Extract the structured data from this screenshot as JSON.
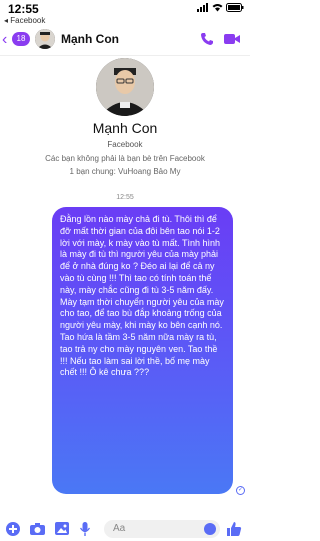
{
  "status": {
    "time": "12:55",
    "back_app": "◂ Facebook"
  },
  "header": {
    "badge": "18",
    "name": "Mạnh Con"
  },
  "profile": {
    "name": "Mạnh Con",
    "subtitle": "Facebook",
    "note": "Các bạn không phải là bạn bè trên Facebook",
    "mutual": "1 bạn chung: VuHoang Bảo My"
  },
  "conversation": {
    "timestamp": "12:55",
    "message": "Đằng lồn nào mày chả đi tù. Thôi thì để đỡ mất thời gian của đôi bên tao nói 1-2 lời với mày, k mày vào tù mất. Tình hình là mày đi tù thì người yêu của mày phải để ở nhà đúng ko ? Đéo ai lại để cả ny vào tù cùng !!! Thì tao có tính toán thế này, mày chắc cũng đi tù 3-5 năm đấy. Mày tạm thời chuyển người yêu của mày cho tao, để tao bù đắp khoảng trống của người yêu mày, khi mày ko bên cạnh nó. Tao hứa là tầm 3-5 năm nữa mày ra tù, tao trả ny cho mày nguyên ven. Tao thề !!! Nếu tao làm sai lời thề, bố mẹ mày chết !!! Ô kê chưa ???"
  },
  "composer": {
    "placeholder": "Aa"
  },
  "colors": {
    "accent": "#8a3cf0",
    "bubble_top": "#6a3df5",
    "bubble_bottom": "#4a78f5"
  }
}
